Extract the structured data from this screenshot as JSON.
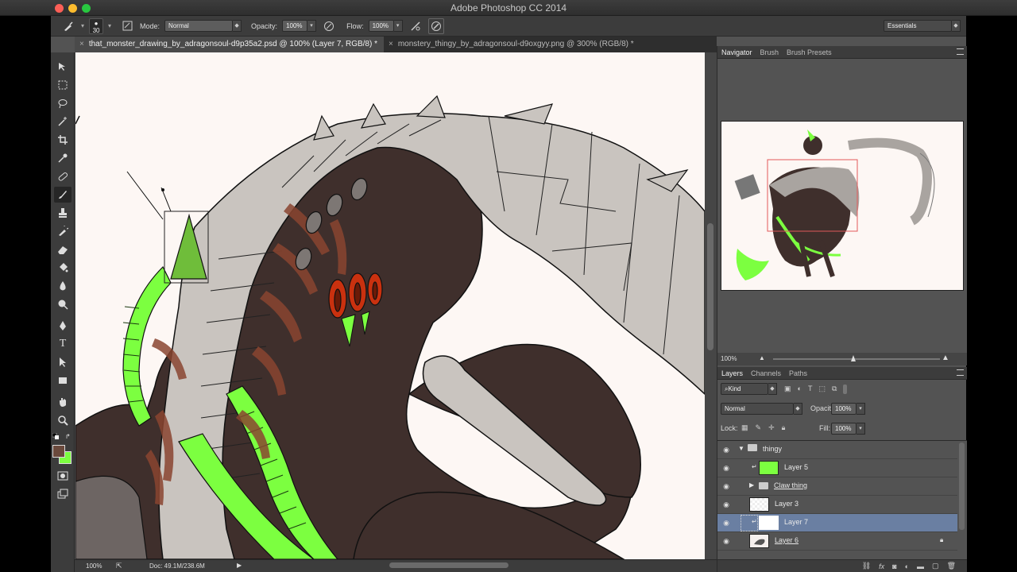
{
  "app": {
    "title": "Adobe Photoshop CC 2014"
  },
  "colors": {
    "foreground": "#6b4a3d",
    "background": "#7cff40",
    "selected_layer": "#6a7fa2",
    "accent_green": "#7cff40",
    "canvas_bg": "#fdf7f4"
  },
  "options_bar": {
    "brush_size": "30",
    "mode_label": "Mode:",
    "mode_value": "Normal",
    "opacity_label": "Opacity:",
    "opacity_value": "100%",
    "flow_label": "Flow:",
    "flow_value": "100%",
    "workspace": "Essentials"
  },
  "tabs": [
    {
      "label": "that_monster_drawing_by_adragonsoul-d9p35a2.psd @ 100% (Layer 7, RGB/8) *"
    },
    {
      "label": "monstery_thingy_by_adragonsoul-d9oxgyy.png @ 300% (RGB/8) *"
    }
  ],
  "status": {
    "zoom": "100%",
    "doc": "Doc: 49.1M/238.6M"
  },
  "navigator_panel": {
    "tabs": [
      "Navigator",
      "Brush",
      "Brush Presets"
    ],
    "zoom": "100%"
  },
  "layers_panel": {
    "tabs": [
      "Layers",
      "Channels",
      "Paths"
    ],
    "filter": "Kind",
    "blend_mode": "Normal",
    "opacity_label": "Opacity:",
    "opacity_value": "100%",
    "lock_label": "Lock:",
    "fill_label": "Fill:",
    "fill_value": "100%",
    "layers": [
      {
        "name": "thingy",
        "type": "group-open"
      },
      {
        "name": "Layer 5",
        "type": "clipped-green"
      },
      {
        "name": "Claw thing",
        "type": "group-closed"
      },
      {
        "name": "Layer 3",
        "type": "layer"
      },
      {
        "name": "Layer 7",
        "type": "clipped-selected"
      },
      {
        "name": "Layer 6",
        "type": "layer-locked"
      }
    ]
  },
  "icons": {
    "tools": [
      "move-tool-icon",
      "marquee-tool-icon",
      "lasso-tool-icon",
      "magic-wand-icon",
      "crop-tool-icon",
      "eyedropper-icon",
      "healing-brush-icon",
      "brush-tool-icon",
      "clone-stamp-icon",
      "history-brush-icon",
      "eraser-icon",
      "paint-bucket-icon",
      "blur-icon",
      "dodge-icon",
      "pen-tool-icon",
      "type-tool-icon",
      "path-select-icon",
      "rectangle-tool-icon",
      "hand-tool-icon",
      "zoom-tool-icon"
    ]
  }
}
